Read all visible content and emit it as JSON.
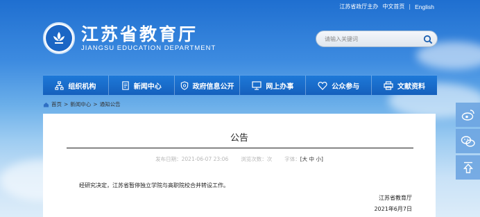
{
  "toplinks": {
    "mobile": "江苏省政厅主办",
    "zh": "中文首页",
    "sep": "|",
    "en": "English"
  },
  "header": {
    "title": "江苏省教育厅",
    "subtitle": "JIANGSU EDUCATION DEPARTMENT"
  },
  "search": {
    "placeholder": "请输入关键词"
  },
  "nav": [
    {
      "label": "组织机构",
      "icon": "org-chart-icon"
    },
    {
      "label": "新闻中心",
      "icon": "document-icon"
    },
    {
      "label": "政府信息公开",
      "icon": "shield-icon"
    },
    {
      "label": "网上办事",
      "icon": "monitor-icon"
    },
    {
      "label": "公众参与",
      "icon": "heart-icon"
    },
    {
      "label": "文献资料",
      "icon": "print-icon"
    }
  ],
  "breadcrumb": {
    "home": "首页",
    "sep1": ">",
    "news": "新闻中心",
    "sep2": ">",
    "current": "通知公告"
  },
  "article": {
    "title": "公告",
    "publish_label": "发布日期：",
    "publish_date": "2021-06-07 23:06",
    "views_label": "浏览次数：",
    "views_unit": "次",
    "fontsize_label": "字体：",
    "fontsize_open": "[",
    "size_large": "大",
    "size_medium": "中",
    "size_small": "小",
    "fontsize_close": "]",
    "body": "经研究决定，江苏省暂停独立学院与高职院校合并转设工作。",
    "signature": "江苏省教育厅",
    "date": "2021年6月7日"
  },
  "side_tools": [
    "weibo-icon",
    "wechat-icon",
    "back-to-top-icon"
  ],
  "colors": {
    "nav_bg": "#1a6ccb",
    "sky_top": "#1f6fd0"
  }
}
